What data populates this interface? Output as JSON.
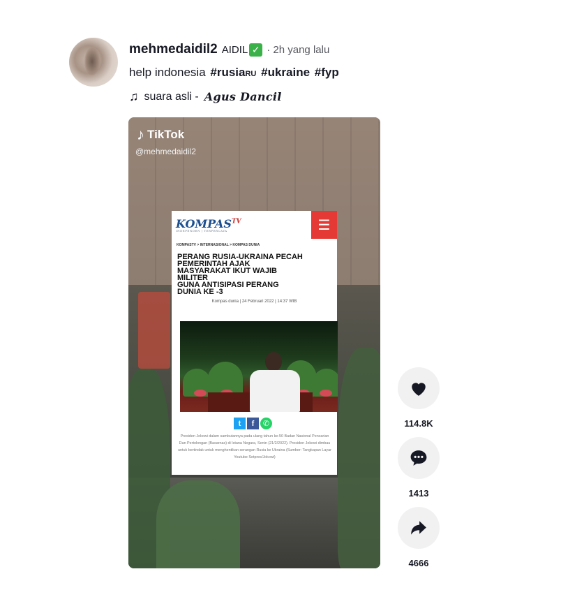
{
  "post": {
    "username": "mehmedaidil2",
    "nickname": "AIDIL",
    "verified_glyph": "✓",
    "time": "· 2h yang lalu",
    "caption_text": "help indonesia",
    "tags": [
      "#rusia",
      "#ukraine",
      "#fyp"
    ],
    "tag_suffix": "RU",
    "music_prefix": "suara asli - ",
    "music_artist": "Agus Dancil"
  },
  "video": {
    "logo": "TikTok",
    "handle": "@mehmedaidil2",
    "card": {
      "brand": "KOMPAS",
      "brand_sup": "TV",
      "brand_sub": "INDEPENDEN | TERPERCAYA",
      "breadcrumb": "KOMPASTV > INTERNASIONAL > KOMPAS DUNIA",
      "headline_lines": [
        "PERANG RUSIA-UKRAINA PECAH",
        "PEMERINTAH AJAK",
        "MASYARAKAT IKUT WAJIB",
        "MILITER",
        "GUNA ANTISIPASI PERANG",
        "DUNIA KE -3"
      ],
      "dateline": "Kompas dunia | 24 Februari 2022 | 14:37 WIB",
      "photo_caption": "Presiden Jokowi dalam sambutannya pada ulang tahun ke-50 Badan Nasional Pencarian Dan Pertolongan (Basarnas) di Istana Negara, Senin (21/2/2022). Presiden Jokowi dimbau untuk bertindak untuk menghentikan serangan Rusia ke Ukraina (Sumber: Tangkapan Layar Youtube Setpres/Jokowi)"
    }
  },
  "actions": {
    "likes": "114.8K",
    "comments": "1413",
    "shares": "4666"
  },
  "icons": {
    "like": "heart-icon",
    "comment": "comment-icon",
    "share": "share-icon",
    "music": "music-note-icon"
  },
  "colors": {
    "verified": "#3bb14a",
    "kompas_blue": "#1d4f8f",
    "kompas_red": "#e53935"
  }
}
